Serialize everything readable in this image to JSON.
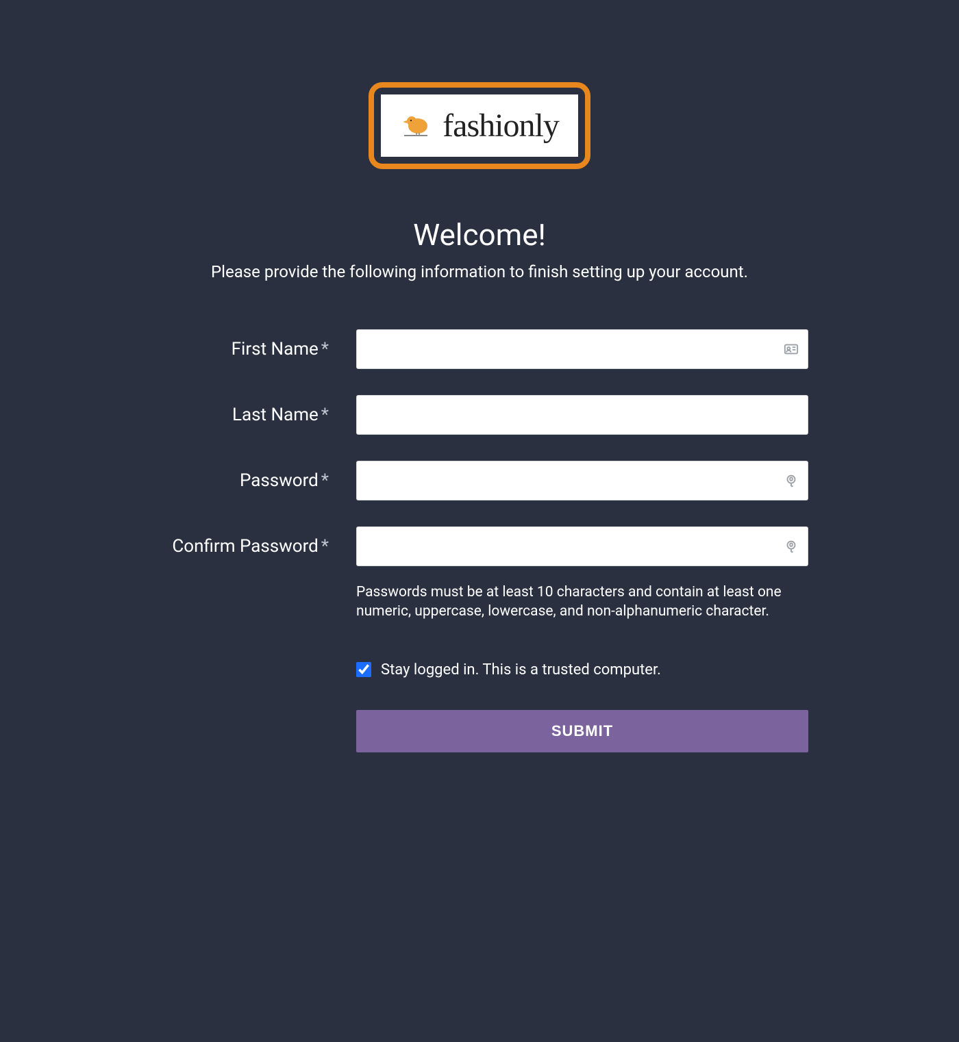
{
  "logo": {
    "brand_name": "fashionly"
  },
  "heading": "Welcome!",
  "subheading": "Please provide the following information to finish setting up your account.",
  "form": {
    "first_name": {
      "label": "First Name",
      "required_mark": "*",
      "value": ""
    },
    "last_name": {
      "label": "Last Name",
      "required_mark": "*",
      "value": ""
    },
    "password": {
      "label": "Password",
      "required_mark": "*",
      "value": ""
    },
    "confirm_password": {
      "label": "Confirm Password",
      "required_mark": "*",
      "value": ""
    },
    "password_hint": "Passwords must be at least 10 characters and contain at least one numeric, uppercase, lowercase, and non-alphanumeric character.",
    "stay_logged_in": {
      "label": "Stay logged in. This is a trusted computer.",
      "checked": true
    },
    "submit_label": "SUBMIT"
  }
}
